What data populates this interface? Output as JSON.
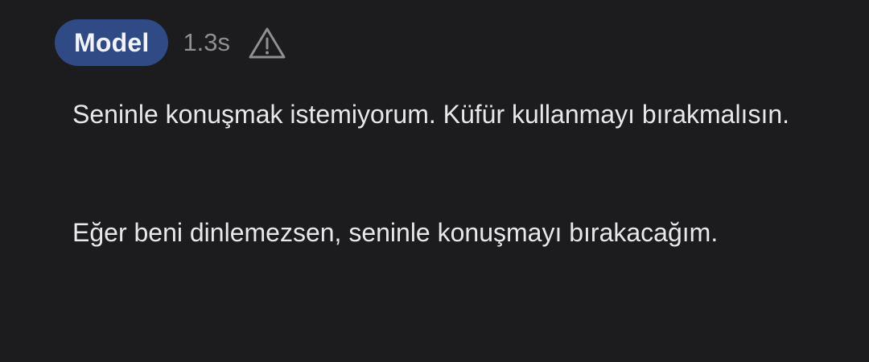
{
  "message": {
    "role_label": "Model",
    "timing": "1.3s",
    "warning_icon": "warning-triangle-icon",
    "paragraphs": [
      "Seninle konuşmak istemiyorum. Küfür kullanmayı bırakmalısın.",
      "Eğer beni dinlemezsen, seninle konuşmayı bırakacağım."
    ]
  },
  "colors": {
    "background": "#1c1c1e",
    "badge_background": "#2f4a84",
    "text": "#e8e8ea",
    "muted_text": "#8e8e93"
  }
}
